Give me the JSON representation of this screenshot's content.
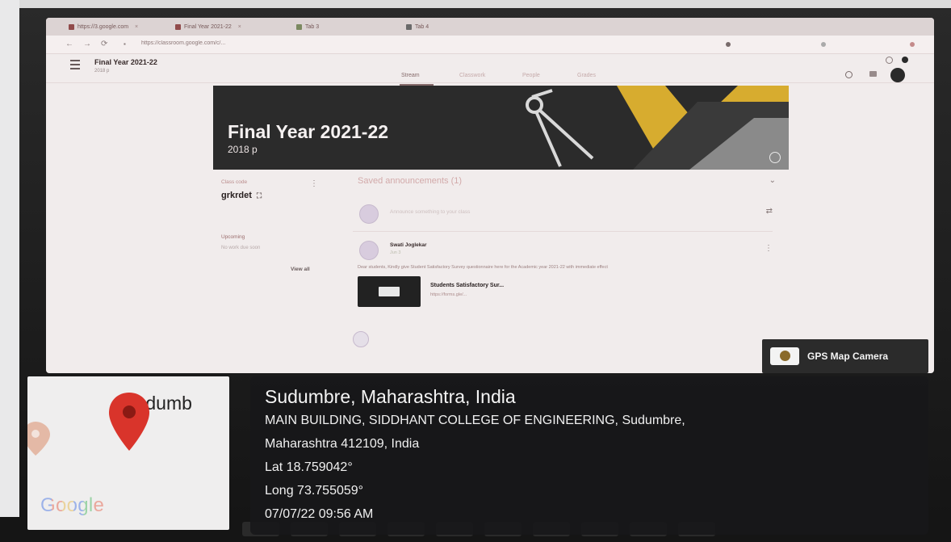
{
  "browser": {
    "tabs": [
      {
        "label": "https://3.google.com"
      },
      {
        "label": "Final Year 2021-22"
      },
      {
        "label": "Tab 3"
      },
      {
        "label": "Tab 4"
      }
    ],
    "url": "https://classroom.google.com/c/..."
  },
  "classroom": {
    "class_title": "Final Year 2021-22",
    "class_subtitle": "2018 p",
    "nav_tabs": [
      {
        "label": "Stream"
      },
      {
        "label": "Classwork"
      },
      {
        "label": "People"
      },
      {
        "label": "Grades"
      }
    ],
    "banner": {
      "title": "Final Year 2021-22",
      "subtitle": "2018 p"
    },
    "class_code_label": "Class code",
    "class_code": "grkrdet",
    "upcoming_label": "Upcoming",
    "no_work_due": "No work due soon",
    "view_all": "View all",
    "saved_announcements": "Saved announcements (1)",
    "announce_placeholder": "Announce something to your class",
    "post": {
      "author": "Swati Joglekar",
      "date": "Jun 3",
      "body": "Dear students, Kindly give Student Satisfactory Survey questionnaire here for the Academic year 2021-22 with immediate effect",
      "attachment_title": "Students Satisfactory Sur...",
      "attachment_url": "https://forms.gle/..."
    }
  },
  "gps_badge": {
    "label": "GPS Map Camera"
  },
  "map": {
    "place_fragment": "ıdumb",
    "logo_text": "Google"
  },
  "location": {
    "title": "Sudumbre, Maharashtra, India",
    "address_line1": "MAIN BUILDING, SIDDHANT COLLEGE OF ENGINEERING, Sudumbre,",
    "address_line2": "Maharashtra 412109, India",
    "lat": "Lat 18.759042°",
    "long": "Long 73.755059°",
    "datetime": "07/07/22 09:56 AM"
  },
  "colors": {
    "pin_red": "#d9342b",
    "overlay_bg": "#18181a",
    "banner_yellow": "#e9b318"
  },
  "icons": [
    "map-pin-icon",
    "menu-icon",
    "info-icon",
    "more-icon",
    "swap-icon",
    "gps-camera-icon"
  ]
}
